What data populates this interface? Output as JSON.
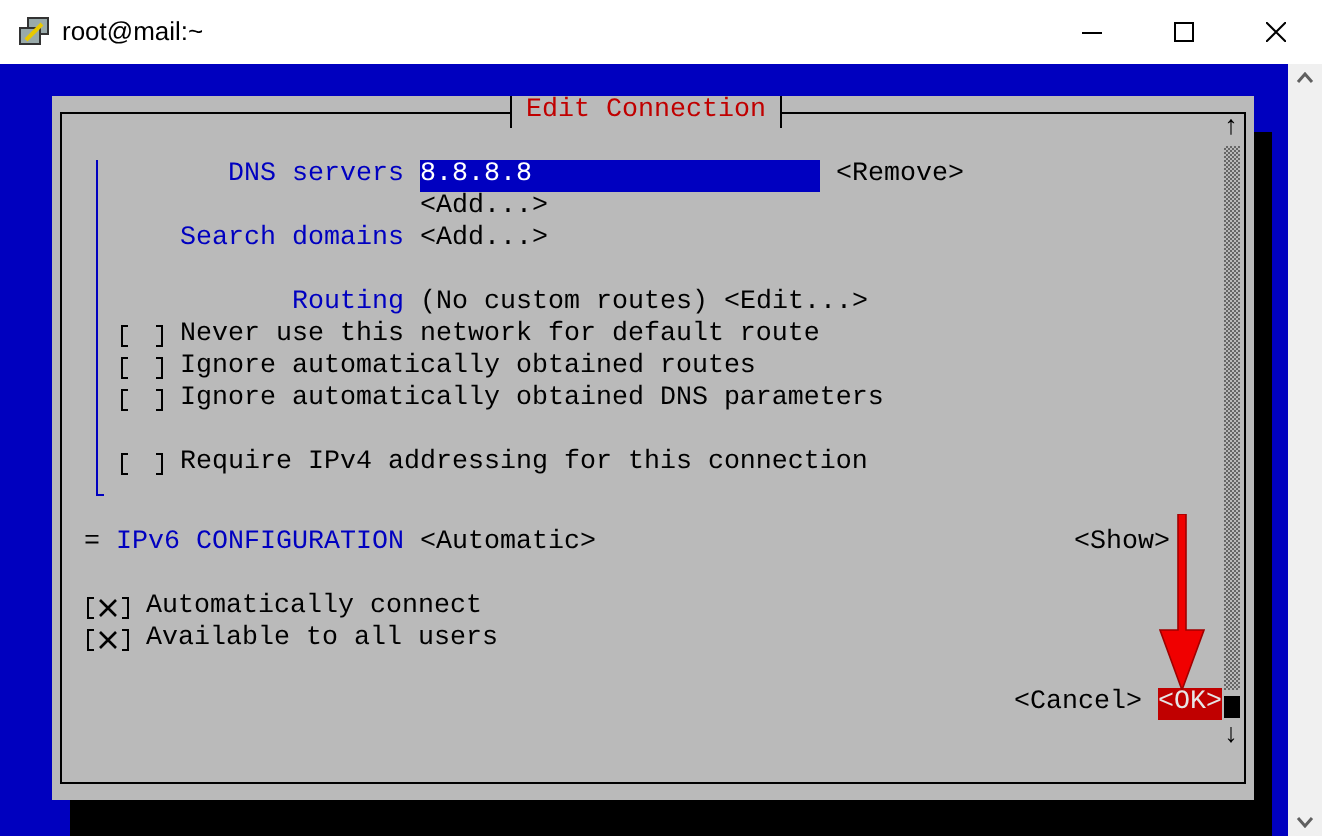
{
  "window": {
    "title": "root@mail:~"
  },
  "dialog": {
    "title": "Edit Connection",
    "scroll_up": "↑",
    "scroll_down": "↓",
    "dns": {
      "label": "DNS servers",
      "value": "8.8.8.8",
      "remove": "<Remove>",
      "add": "<Add...>"
    },
    "search_domains": {
      "label": "Search domains",
      "add": "<Add...>"
    },
    "routing": {
      "label": "Routing",
      "value": "(No custom routes)",
      "edit": "<Edit...>"
    },
    "ipv4_options": [
      {
        "label": "Never use this network for default route",
        "checked": false
      },
      {
        "label": "Ignore automatically obtained routes",
        "checked": false
      },
      {
        "label": "Ignore automatically obtained DNS parameters",
        "checked": false
      }
    ],
    "require_ipv4": {
      "label": "Require IPv4 addressing for this connection",
      "checked": false
    },
    "ipv6": {
      "marker": "=",
      "label": "IPv6 CONFIGURATION",
      "mode": "<Automatic>",
      "show": "<Show>"
    },
    "connection_options": [
      {
        "label": "Automatically connect",
        "checked": true
      },
      {
        "label": "Available to all users",
        "checked": true
      }
    ],
    "buttons": [
      {
        "label": "<Cancel>",
        "selected": false
      },
      {
        "label": "<OK>",
        "selected": true
      }
    ]
  }
}
